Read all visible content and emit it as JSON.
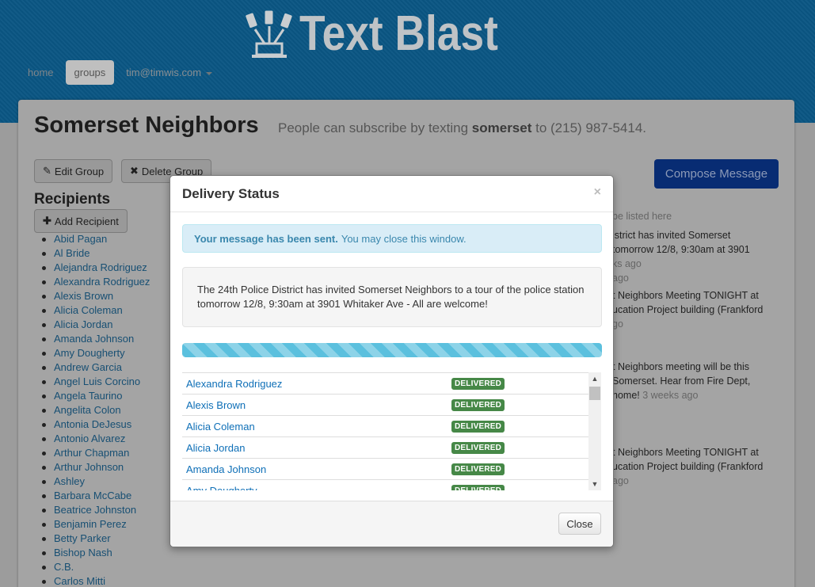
{
  "brand": {
    "name": "Text Blast"
  },
  "nav": {
    "home": "home",
    "groups": "groups",
    "user": "tim@timwis.com"
  },
  "page": {
    "title": "Somerset Neighbors",
    "subtitle_pre": "People can subscribe by texting",
    "subtitle_keyword": "somerset",
    "subtitle_post": "to (215) 987-5414.",
    "edit_label": "Edit Group",
    "delete_label": "Delete Group",
    "compose_label": "Compose Message",
    "recipients_heading": "Recipients",
    "add_recipient_label": "Add Recipient",
    "recipients": [
      "Abid Pagan",
      "Al Bride",
      "Alejandra Rodriguez",
      "Alexandra Rodriguez",
      "Alexis Brown",
      "Alicia Coleman",
      "Alicia Jordan",
      "Amanda Johnson",
      "Amy Dougherty",
      "Andrew Garcia",
      "Angel Luis Corcino",
      "Angela Taurino",
      "Angelita Colon",
      "Antonia DeJesus",
      "Antonio Alvarez",
      "Arthur Chapman",
      "Arthur Johnson",
      "Ashley",
      "Barbara McCabe",
      "Beatrice Johnston",
      "Benjamin Perez",
      "Betty Parker",
      "Bishop Nash",
      "C.B.",
      "Carlos Mitti"
    ]
  },
  "feed": {
    "placeholder": "be listed here",
    "line1": "istrict has invited Somerset",
    "line2": "tomorrow 12/8, 9:30am at 3901",
    "line3": "ks ago",
    "line4": "ago",
    "line5": "t Neighbors Meeting TONIGHT at",
    "line6": "ucation Project building (Frankford",
    "line7": "go",
    "line8": "t Neighbors meeting will be this",
    "line9": "Somerset. Hear from Fire Dept,",
    "line10a": "home!",
    "line10b": "3 weeks ago",
    "line11": "t Neighbors Meeting TONIGHT at",
    "line12": "ucation Project building (Frankford",
    "line13": "ago"
  },
  "modal": {
    "title": "Delivery Status",
    "close_glyph": "×",
    "alert_strong": "Your message has been sent.",
    "alert_text": "You may close this window.",
    "message": "The 24th Police District has invited Somerset Neighbors to a tour of the police station tomorrow 12/8, 9:30am at 3901 Whitaker Ave - All are welcome!",
    "progress": 1.0,
    "rows": [
      {
        "name": "Alexandra Rodriguez",
        "status": "DELIVERED"
      },
      {
        "name": "Alexis Brown",
        "status": "DELIVERED"
      },
      {
        "name": "Alicia Coleman",
        "status": "DELIVERED"
      },
      {
        "name": "Alicia Jordan",
        "status": "DELIVERED"
      },
      {
        "name": "Amanda Johnson",
        "status": "DELIVERED"
      },
      {
        "name": "Amy Dougherty",
        "status": "DELIVERED"
      }
    ],
    "close_label": "Close"
  },
  "colors": {
    "header": "#0a5683",
    "compose": "#082c73",
    "badge": "#468847",
    "link": "#0e6fb7",
    "alert_bg": "#d9edf7"
  }
}
